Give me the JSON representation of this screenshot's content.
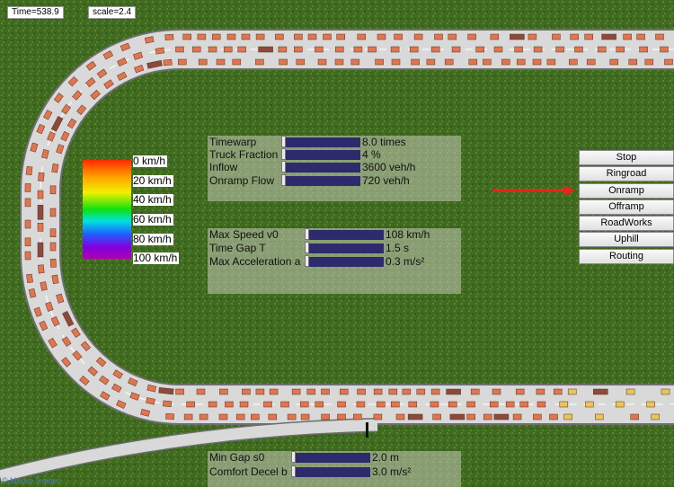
{
  "status": {
    "time": "Time=538.9",
    "scale": "scale=2.4"
  },
  "panel_top": {
    "rows": [
      {
        "label": "Timewarp",
        "value": "8.0 times"
      },
      {
        "label": "Truck Fraction",
        "value": "4 %"
      },
      {
        "label": "Inflow",
        "value": "3600 veh/h"
      },
      {
        "label": "Onramp Flow",
        "value": "720 veh/h"
      }
    ]
  },
  "panel_mid": {
    "rows": [
      {
        "label": "Max Speed v0",
        "value": "108 km/h"
      },
      {
        "label": "Time Gap T",
        "value": "1.5 s"
      },
      {
        "label": "Max Acceleration a",
        "value": "0.3 m/s²"
      }
    ]
  },
  "panel_bottom": {
    "rows": [
      {
        "label": "Min Gap s0",
        "value": "2.0 m"
      },
      {
        "label": "Comfort Decel b",
        "value": "3.0 m/s²"
      }
    ]
  },
  "legend": {
    "labels": [
      "0 km/h",
      "20 km/h",
      "40 km/h",
      "60 km/h",
      "80 km/h",
      "100 km/h"
    ]
  },
  "buttons": [
    "Stop",
    "Ringroad",
    "Onramp",
    "Offramp",
    "RoadWorks",
    "Uphill",
    "Routing"
  ],
  "credit": "© Martin Treiber",
  "colors": {
    "grass": "#3f6a20",
    "road": "#dcdcdc",
    "slider_track": "#2d2b6e",
    "arrow": "#e8251b",
    "car": "#e07550",
    "truck": "#8b4a3c",
    "fast_car": "#e9c65a"
  },
  "icons": {
    "arrow": "arrow-right-icon"
  }
}
